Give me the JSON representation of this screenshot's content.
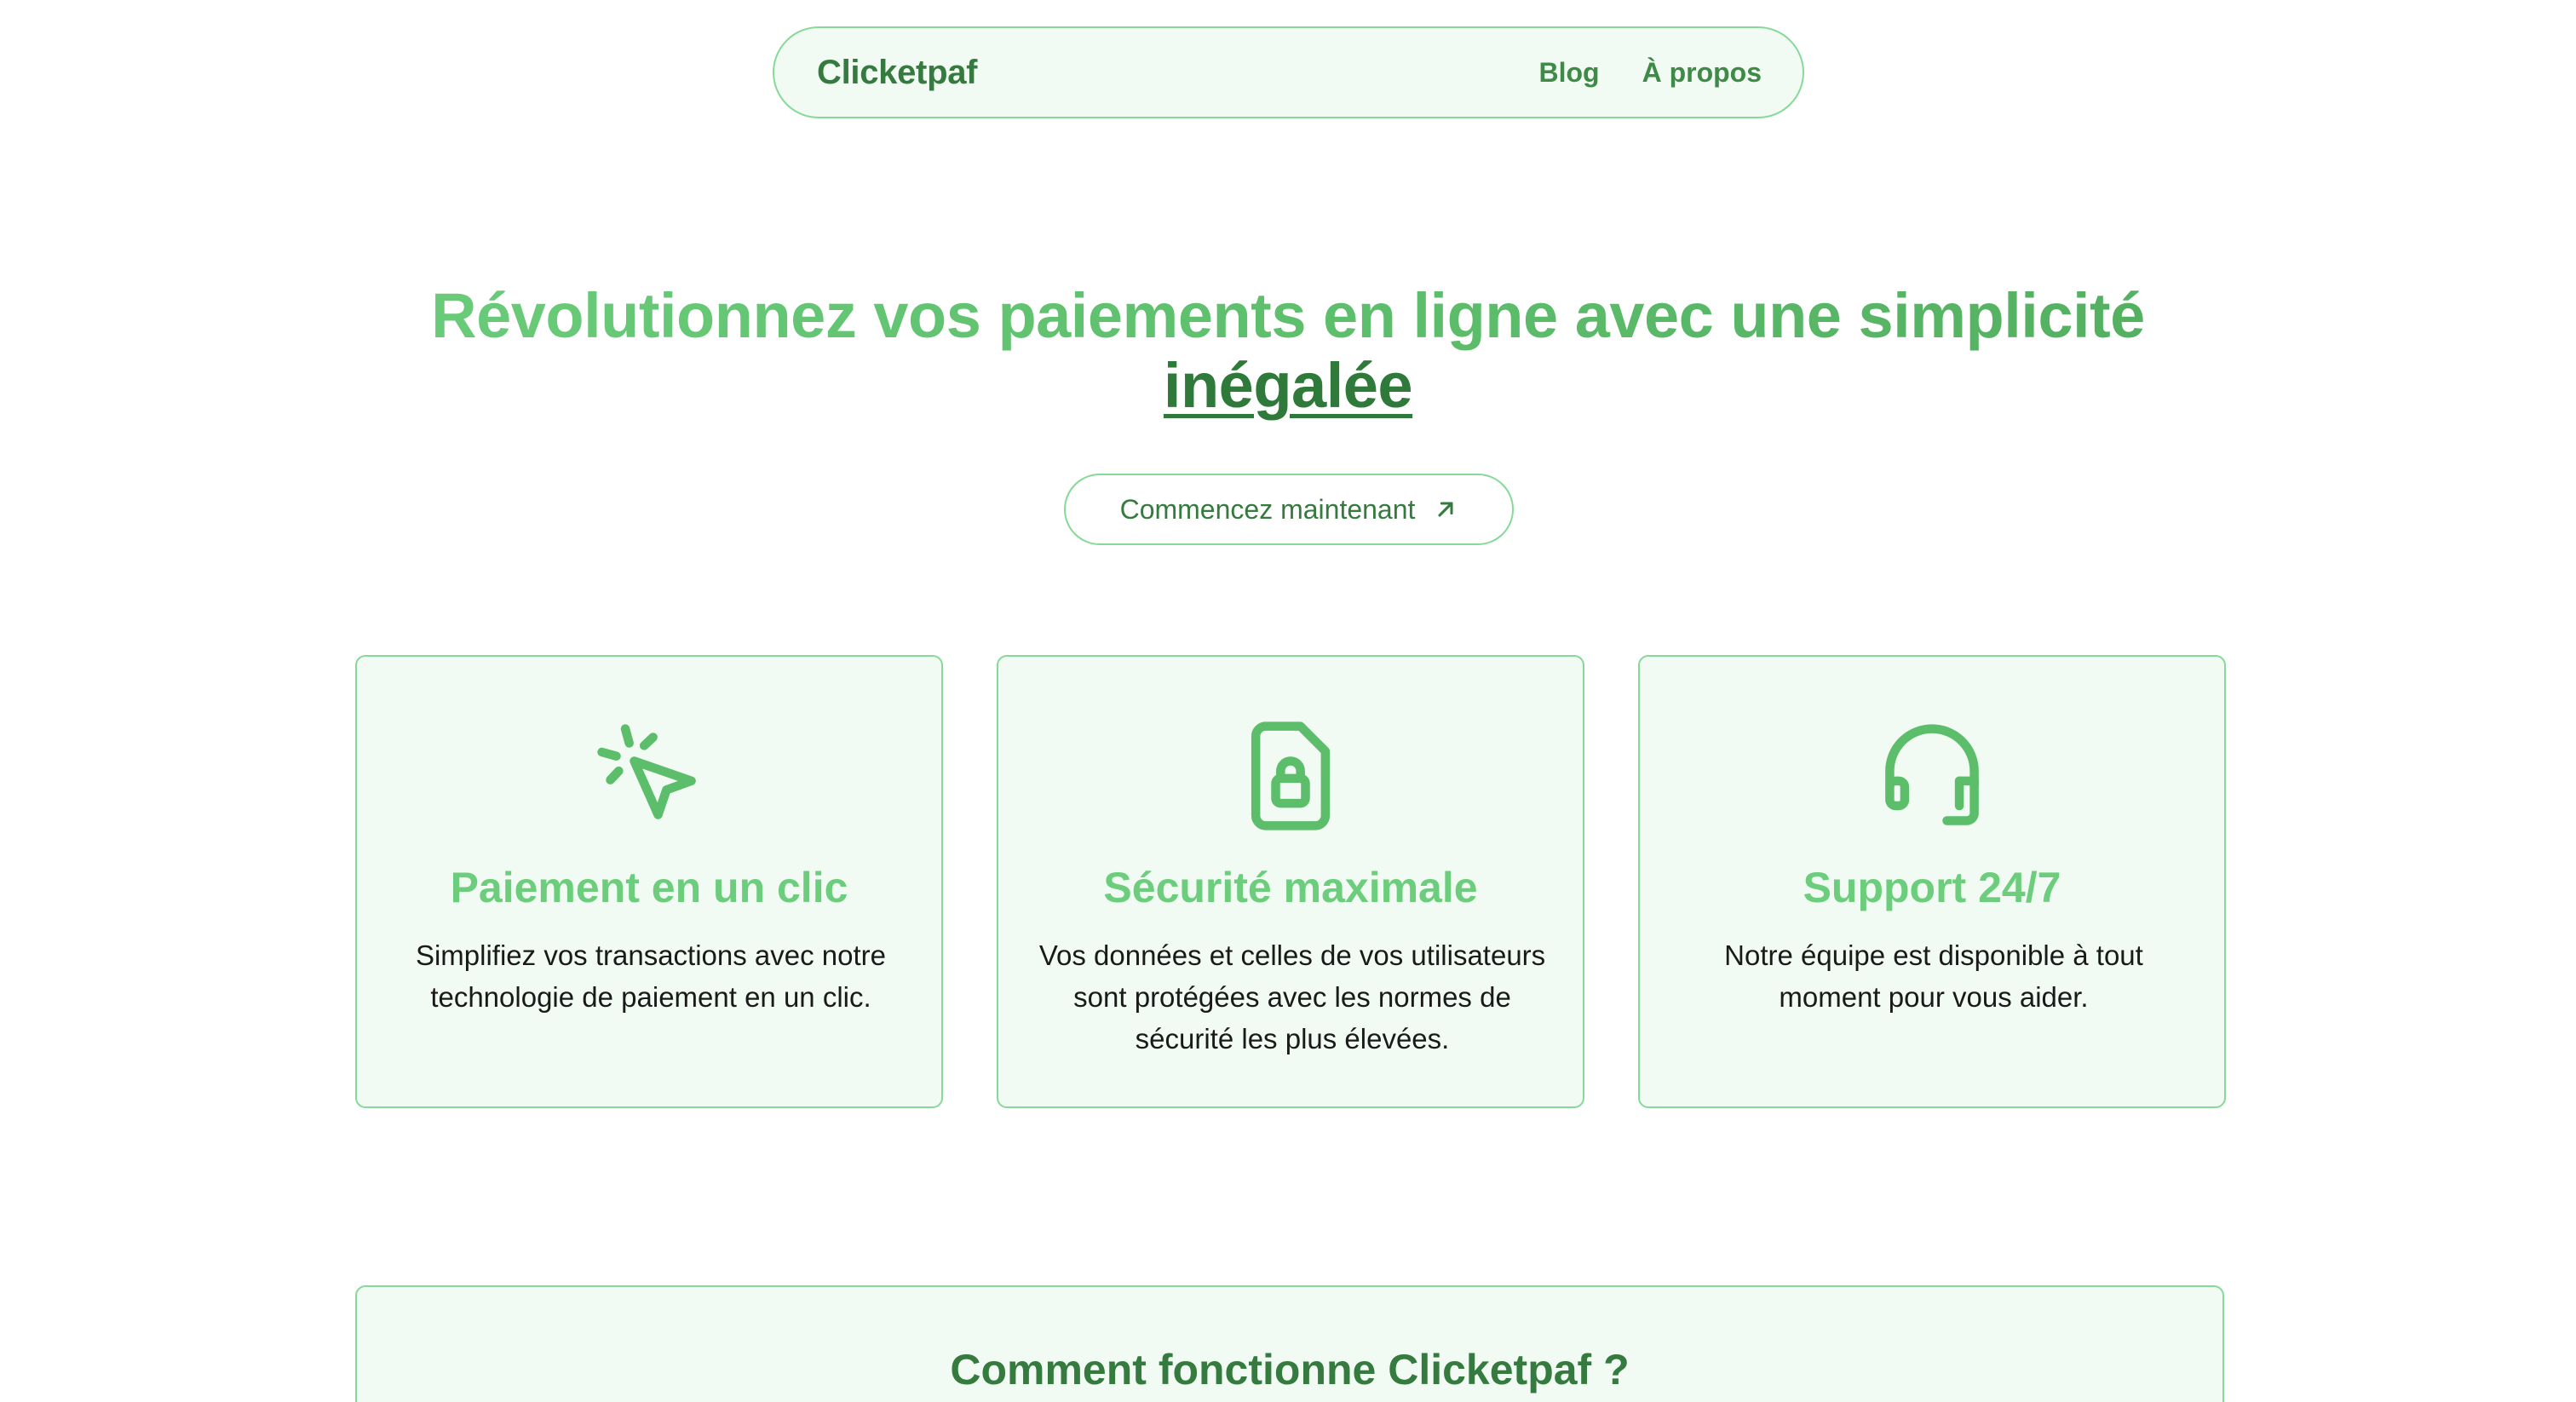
{
  "brand": {
    "name": "Clicketpaf"
  },
  "nav": {
    "links": [
      {
        "label": "Blog"
      },
      {
        "label": "À propos"
      }
    ]
  },
  "hero": {
    "title_line1": "Révolutionnez vos paiements en ligne avec une simplicité",
    "title_line2": "inégalée",
    "cta_label": "Commencez maintenant",
    "cta_icon": "arrow-up-right-icon"
  },
  "features": [
    {
      "icon": "cursor-click-icon",
      "title": "Paiement en un clic",
      "text": "Simplifiez vos transactions avec notre technologie de paiement en un clic."
    },
    {
      "icon": "file-lock-icon",
      "title": "Sécurité maximale",
      "text": "Vos données et celles de vos utilisateurs sont protégées avec les normes de sécurité les plus élevées."
    },
    {
      "icon": "headset-icon",
      "title": "Support 24/7",
      "text": "Notre équipe est disponible à tout moment pour vous aider."
    }
  ],
  "how_it_works": {
    "title": "Comment fonctionne Clicketpaf ?"
  },
  "colors": {
    "accent": "#6ccd7c",
    "accent_dark": "#357a3e",
    "border": "#86d997",
    "card_bg": "#f1fbf3"
  }
}
